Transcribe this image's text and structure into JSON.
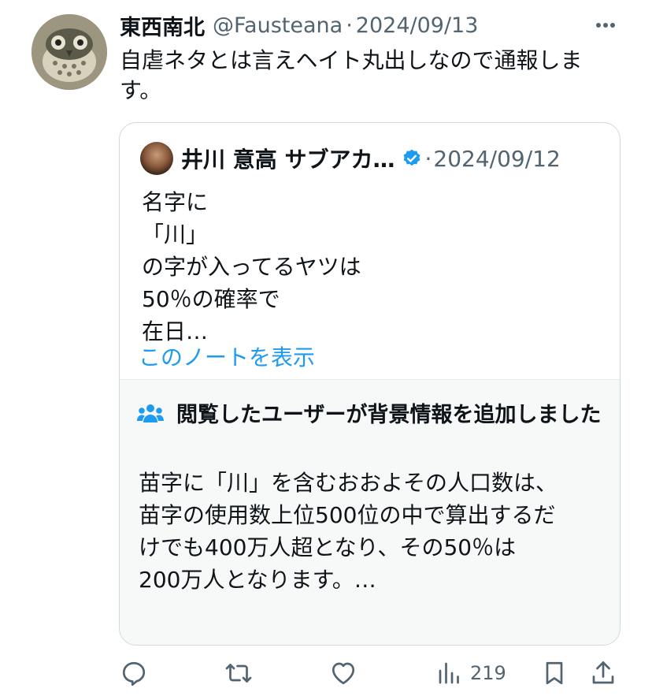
{
  "tweet": {
    "author_name": "東西南北",
    "handle": "@Fausteana",
    "separator": "·",
    "date": "2024/09/13",
    "text": "自虐ネタとは言えヘイト丸出しなので通報しま\nす。"
  },
  "quote": {
    "author_name": "井川 意高 サブアカ…",
    "separator": "·",
    "date": "2024/09/12",
    "text": "名字に\n「川」\nの字が入ってるヤツは\n50％の確率で\n在日…",
    "verified_color": "#1d9bf0"
  },
  "community_note": {
    "title": "閲覧したユーザーが背景情報を追加しました",
    "text": "苗字に「川」を含むおおよその人口数は、\n苗字の使用数上位500位の中で算出するだ\nけでも400万人超となり、その50％は\n200万人となります。…",
    "link_label": "このノートを表示",
    "link_color": "#1d9bf0",
    "icon": "community-notes-icon"
  },
  "actions": {
    "reply_icon": "reply-icon",
    "retweet_icon": "retweet-icon",
    "like_icon": "like-icon",
    "views_icon": "views-icon",
    "views_count": "219",
    "bookmark_icon": "bookmark-icon",
    "share_icon": "share-icon"
  }
}
